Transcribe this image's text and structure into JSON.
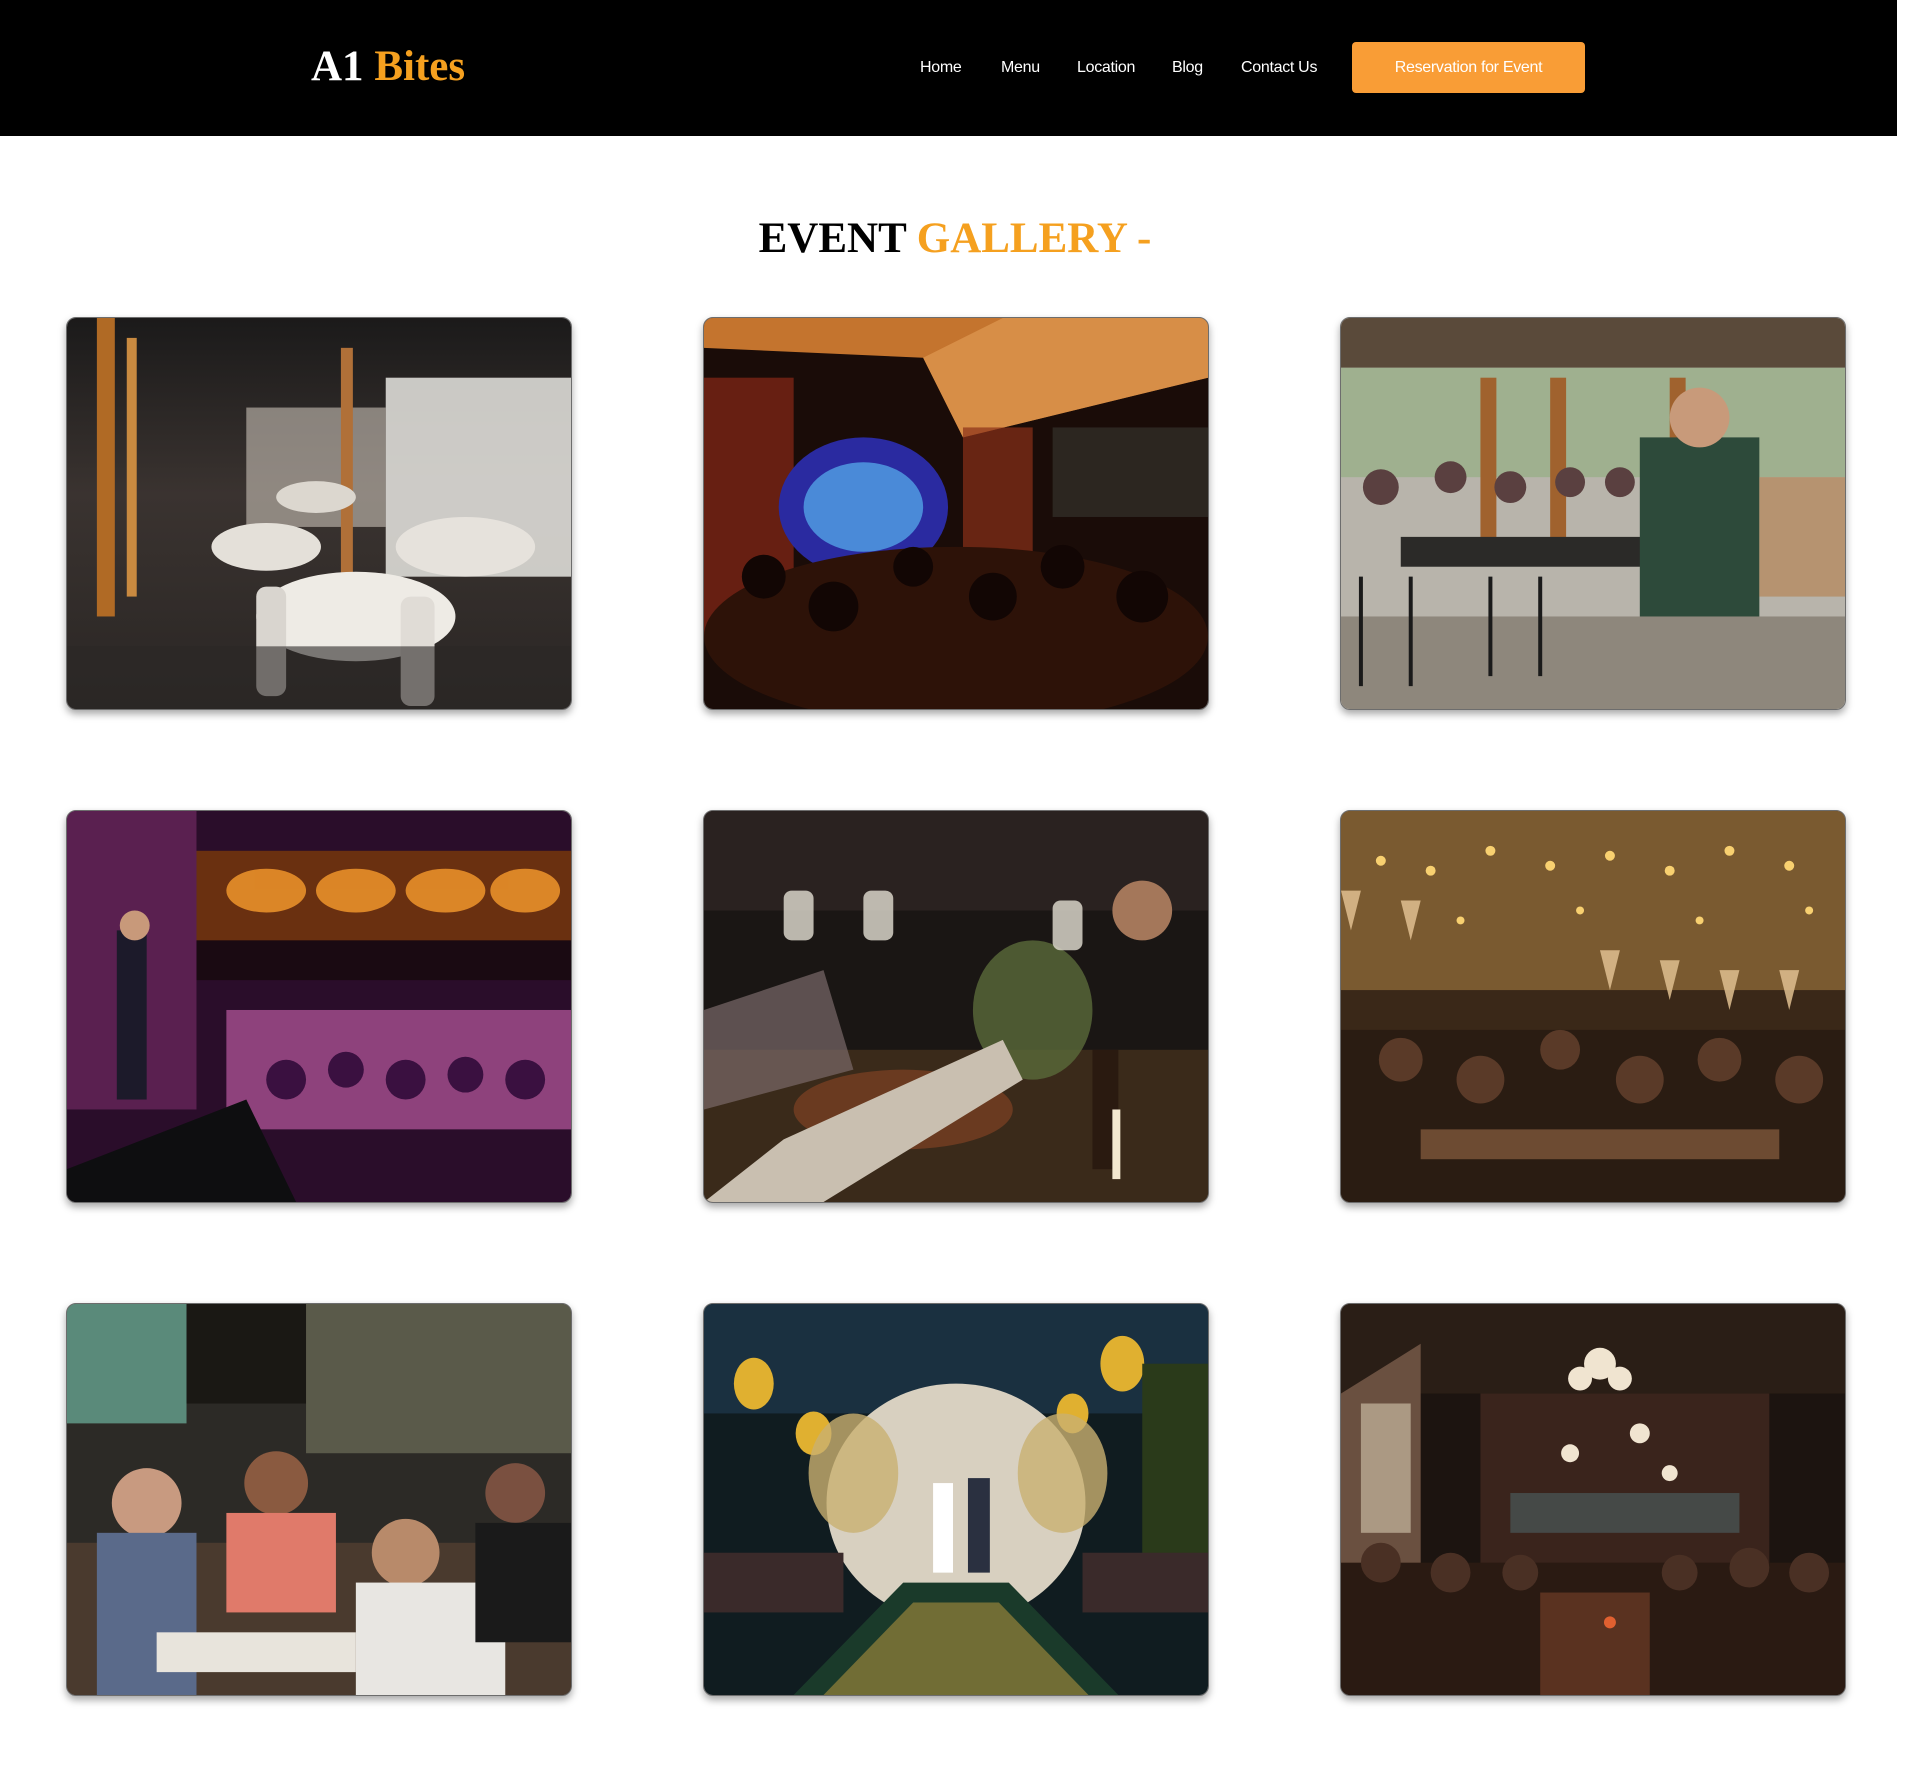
{
  "header": {
    "logo_first": "A1",
    "logo_second": "Bites",
    "nav": [
      "Home",
      "Menu",
      "Location",
      "Blog",
      "Contact Us"
    ],
    "cta_label": "Reservation for Event"
  },
  "gallery": {
    "title_first": "EVENT",
    "title_second": "GALLERY -",
    "images": [
      "banquet-hall-photo",
      "live-music-venue-photo",
      "patio-speech-photo",
      "concert-stage-photo",
      "wine-toast-photo",
      "string-lights-dinner-photo",
      "restaurant-diners-photo",
      "wedding-ceremony-photo",
      "chandelier-dining-room-photo"
    ]
  },
  "colors": {
    "accent": "#f5a01f",
    "button": "#f99d36",
    "header_bg": "#000000"
  }
}
